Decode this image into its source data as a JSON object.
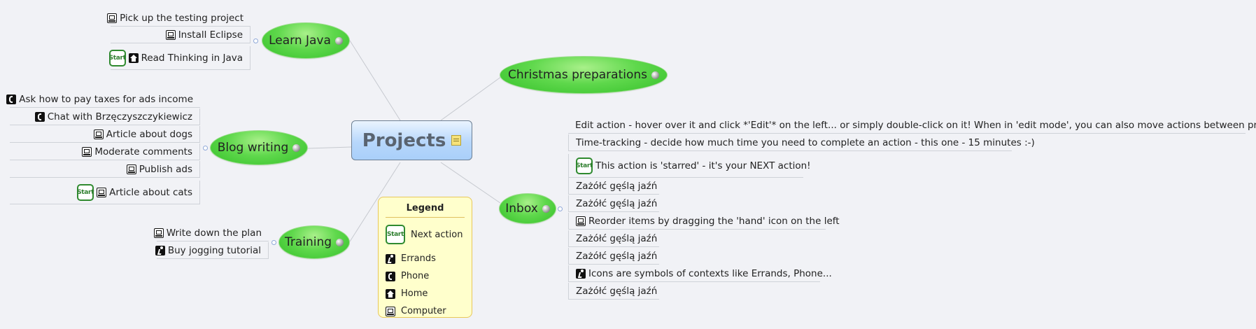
{
  "center": {
    "title": "Projects"
  },
  "branches": {
    "learn_java": {
      "title": "Learn Java",
      "items": [
        "Pick up the testing project",
        "Install Eclipse",
        "Read Thinking in Java"
      ]
    },
    "blog_writing": {
      "title": "Blog writing",
      "items": [
        "Ask how to pay taxes for ads income",
        "Chat with Brzęczyszczykiewicz",
        "Article about dogs",
        "Moderate comments",
        "Publish ads",
        "Article about cats"
      ]
    },
    "training": {
      "title": "Training",
      "items": [
        "Write down the plan",
        "Buy jogging tutorial"
      ]
    },
    "christmas": {
      "title": "Christmas preparations"
    },
    "inbox": {
      "title": "Inbox",
      "items": [
        "Edit action - hover over it and click *'Edit'* on the left... or simply double-click on it! When in 'edit mode', you can also move actions between projects.",
        "Time-tracking - decide how much time you need to complete an action - this one - 15 minutes :-)",
        "This action is 'starred' - it's your NEXT action!",
        "Zażółć gęślą jaźń",
        "Zażółć gęślą jaźń",
        "Reorder items by dragging the 'hand' icon on the left",
        "Zażółć gęślą jaźń",
        "Zażółć gęślą jaźń",
        "Icons are symbols of contexts like Errands, Phone...",
        "Zażółć gęślą jaźń"
      ]
    }
  },
  "start_badge": "Start",
  "legend": {
    "title": "Legend",
    "items": [
      "Next action",
      "Errands",
      "Phone",
      "Home",
      "Computer"
    ]
  },
  "icons": [
    "start-badge",
    "errands-icon",
    "phone-icon",
    "home-icon",
    "computer-icon",
    "globe-icon",
    "note-icon"
  ],
  "colors": {
    "branch_green": "#4fd23e",
    "center_blue": "#b7d7fb",
    "legend_yellow": "#ffffcc",
    "start_green": "#2f8a2f"
  }
}
